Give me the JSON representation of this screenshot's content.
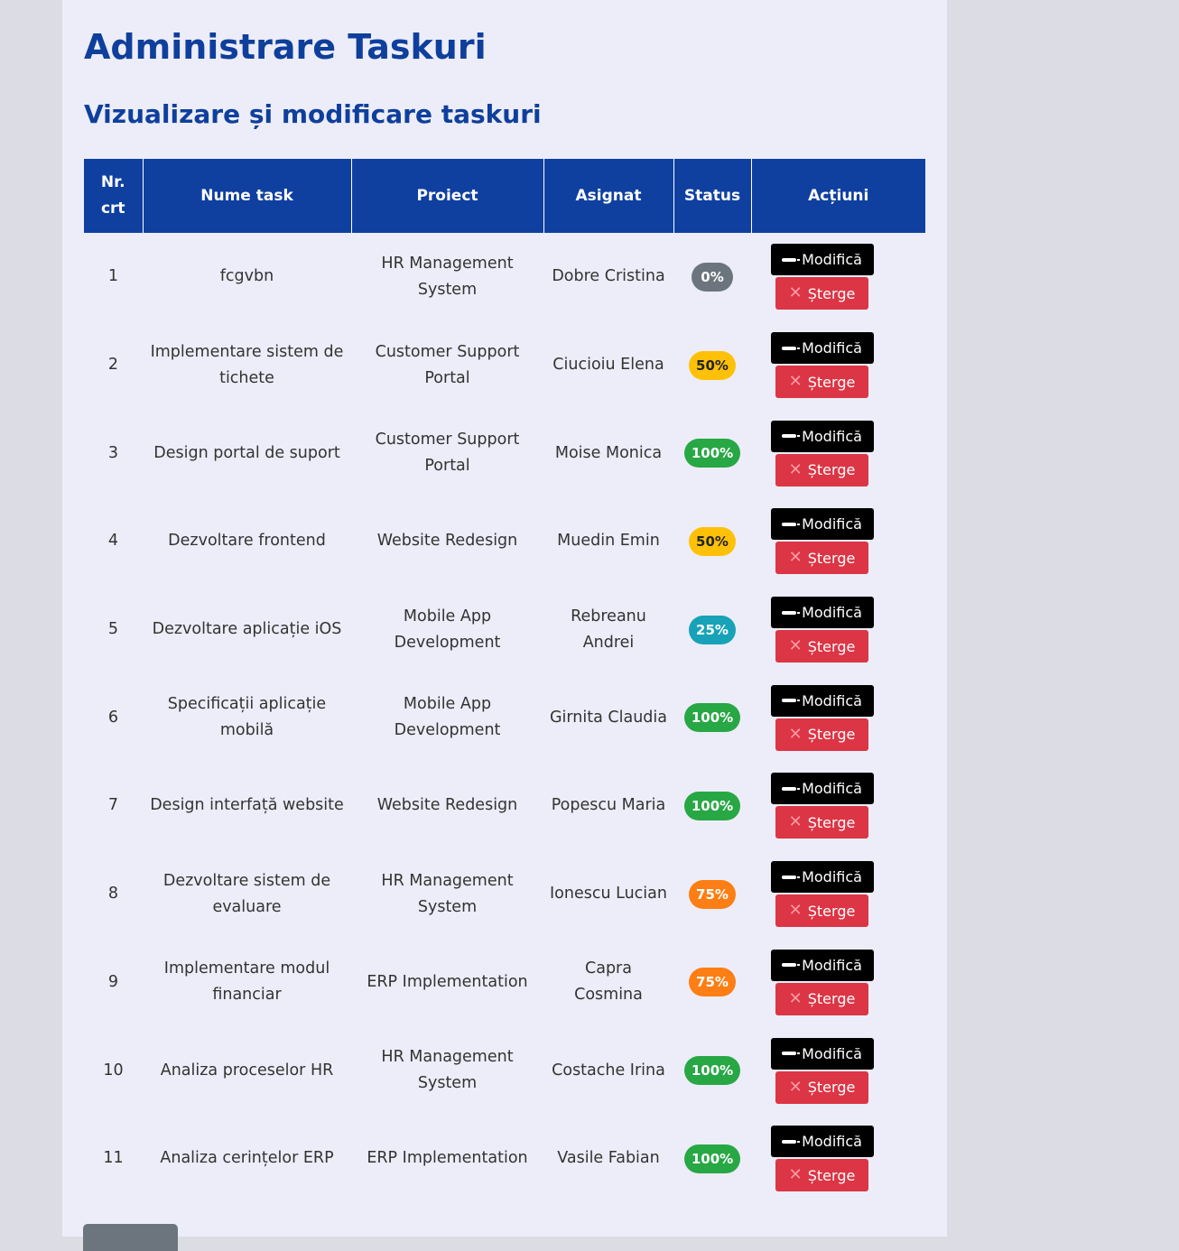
{
  "page": {
    "title": "Administrare Taskuri",
    "subtitle": "Vizualizare și modificare taskuri"
  },
  "table": {
    "headers": {
      "nr": "Nr. crt",
      "name": "Nume task",
      "project": "Proiect",
      "assignee": "Asignat",
      "status": "Status",
      "actions": "Acțiuni"
    },
    "edit_label": "Modifică",
    "delete_label": "Șterge",
    "rows": [
      {
        "nr": "1",
        "name": "fcgvbn",
        "project": "HR Management System",
        "assignee": "Dobre Cristina",
        "status": "0%",
        "status_color": "#6c757d"
      },
      {
        "nr": "2",
        "name": "Implementare sistem de tichete",
        "project": "Customer Support Portal",
        "assignee": "Ciucioiu Elena",
        "status": "50%",
        "status_color": "#ffc107"
      },
      {
        "nr": "3",
        "name": "Design portal de suport",
        "project": "Customer Support Portal",
        "assignee": "Moise Monica",
        "status": "100%",
        "status_color": "#28a745"
      },
      {
        "nr": "4",
        "name": "Dezvoltare frontend",
        "project": "Website Redesign",
        "assignee": "Muedin Emin",
        "status": "50%",
        "status_color": "#ffc107"
      },
      {
        "nr": "5",
        "name": "Dezvoltare aplicație iOS",
        "project": "Mobile App Development",
        "assignee": "Rebreanu Andrei",
        "status": "25%",
        "status_color": "#17a2b8"
      },
      {
        "nr": "6",
        "name": "Specificații aplicație mobilă",
        "project": "Mobile App Development",
        "assignee": "Girnita Claudia",
        "status": "100%",
        "status_color": "#28a745"
      },
      {
        "nr": "7",
        "name": "Design interfață website",
        "project": "Website Redesign",
        "assignee": "Popescu Maria",
        "status": "100%",
        "status_color": "#28a745"
      },
      {
        "nr": "8",
        "name": "Dezvoltare sistem de evaluare",
        "project": "HR Management System",
        "assignee": "Ionescu Lucian",
        "status": "75%",
        "status_color": "#fd7e14"
      },
      {
        "nr": "9",
        "name": "Implementare modul financiar",
        "project": "ERP Implementation",
        "assignee": "Capra Cosmina",
        "status": "75%",
        "status_color": "#fd7e14"
      },
      {
        "nr": "10",
        "name": "Analiza proceselor HR",
        "project": "HR Management System",
        "assignee": "Costache Irina",
        "status": "100%",
        "status_color": "#28a745"
      },
      {
        "nr": "11",
        "name": "Analiza cerințelor ERP",
        "project": "ERP Implementation",
        "assignee": "Vasile Fabian",
        "status": "100%",
        "status_color": "#28a745"
      }
    ]
  },
  "icons": {
    "edit": "pen-icon",
    "delete": "close-icon"
  }
}
